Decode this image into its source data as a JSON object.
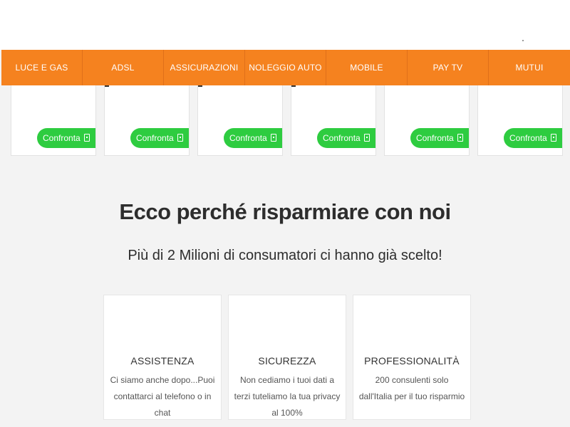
{
  "nav": {
    "items": [
      {
        "label": "LUCE E GAS"
      },
      {
        "label": "ADSL"
      },
      {
        "label": "ASSICURAZIONI"
      },
      {
        "label": "NOLEGGIO AUTO"
      },
      {
        "label": "MOBILE"
      },
      {
        "label": "PAY TV"
      },
      {
        "label": "MUTUI"
      }
    ]
  },
  "cards": [
    {
      "cta_label": "Confronta",
      "icon": "mobile-phone-icon"
    },
    {
      "cta_label": "Confronta",
      "icon": "mobile-phone-icon"
    },
    {
      "cta_label": "Confronta",
      "icon": "mobile-phone-icon"
    },
    {
      "cta_label": "Confronta",
      "icon": "mobile-phone-icon"
    },
    {
      "cta_label": "Confronta",
      "icon": "mobile-phone-icon"
    },
    {
      "cta_label": "Confronta",
      "icon": "mobile-phone-icon"
    }
  ],
  "why": {
    "title": "Ecco perché risparmiare con noi",
    "subtitle": "Più di 2 Milioni di consumatori ci hanno già scelto!"
  },
  "features": [
    {
      "title": "ASSISTENZA",
      "desc": "Ci siamo anche dopo...Puoi contattarci al telefono o in chat"
    },
    {
      "title": "SICUREZZA",
      "desc": "Non cediamo i tuoi dati a terzi tuteliamo la tua privacy al 100%"
    },
    {
      "title": "PROFESSIONALITÀ",
      "desc": "200 consulenti solo dall'Italia per il tuo risparmio"
    }
  ],
  "colors": {
    "nav_bg": "#f5821f",
    "cta_bg": "#2ecc40",
    "page_bg": "#f3f3f3",
    "text_dark": "#2d2d2d"
  }
}
